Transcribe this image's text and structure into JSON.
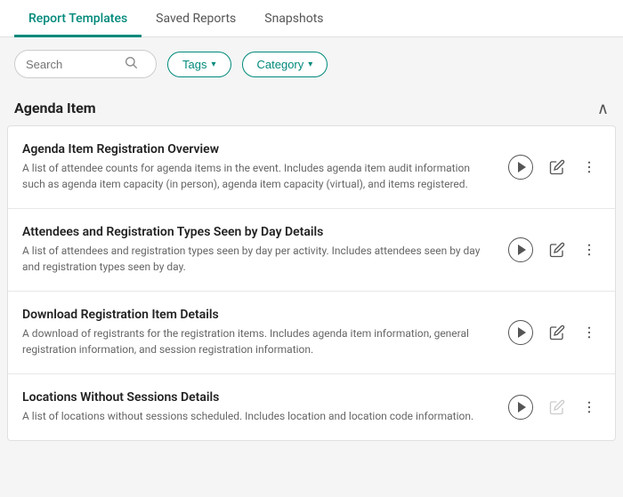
{
  "tabs": [
    {
      "id": "report-templates",
      "label": "Report Templates",
      "active": true
    },
    {
      "id": "saved-reports",
      "label": "Saved Reports",
      "active": false
    },
    {
      "id": "snapshots",
      "label": "Snapshots",
      "active": false
    }
  ],
  "toolbar": {
    "search_placeholder": "Search",
    "tags_label": "Tags",
    "category_label": "Category"
  },
  "section": {
    "title": "Agenda Item",
    "collapse_symbol": "∧"
  },
  "reports": [
    {
      "name": "Agenda Item Registration Overview",
      "desc": "A list of attendee counts for agenda items in the event. Includes agenda item audit information such as agenda item capacity (in person), agenda item capacity (virtual), and items registered.",
      "play_disabled": false,
      "edit_disabled": false
    },
    {
      "name": "Attendees and Registration Types Seen by Day Details",
      "desc": "A list of attendees and registration types seen by day per activity. Includes attendees seen by day and registration types seen by day.",
      "play_disabled": false,
      "edit_disabled": false
    },
    {
      "name": "Download Registration Item Details",
      "desc": "A download of registrants for the registration items. Includes agenda item information, general registration information, and session registration information.",
      "play_disabled": false,
      "edit_disabled": false
    },
    {
      "name": "Locations Without Sessions Details",
      "desc": "A list of locations without sessions scheduled. Includes location and location code information.",
      "play_disabled": false,
      "edit_disabled": true
    }
  ]
}
